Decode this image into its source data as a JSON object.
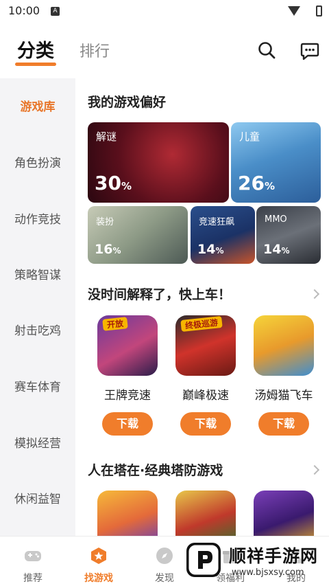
{
  "status_bar": {
    "time": "10:00",
    "notification_letter": "A"
  },
  "header": {
    "tab_category": "分类",
    "tab_ranking": "排行",
    "search_icon": "search-icon",
    "message_icon": "chat-icon",
    "accent": "#f07d2b"
  },
  "sidebar": {
    "items": [
      {
        "label": "游戏库",
        "active": true
      },
      {
        "label": "角色扮演"
      },
      {
        "label": "动作竞技"
      },
      {
        "label": "策略智谋"
      },
      {
        "label": "射击吃鸡"
      },
      {
        "label": "赛车体育"
      },
      {
        "label": "模拟经营"
      },
      {
        "label": "休闲益智"
      }
    ]
  },
  "preferences": {
    "title": "我的游戏偏好",
    "cards": [
      {
        "label": "解谜",
        "percent": "30",
        "unit": "%"
      },
      {
        "label": "儿童",
        "percent": "26",
        "unit": "%"
      },
      {
        "label": "装扮",
        "percent": "16",
        "unit": "%"
      },
      {
        "label": "竞速狂飙",
        "percent": "14",
        "unit": "%"
      },
      {
        "label": "MMO",
        "percent": "14",
        "unit": "%"
      }
    ]
  },
  "section_quick": {
    "title": "没时间解释了，快上车！",
    "games": [
      {
        "name": "王牌竞速",
        "badge": "开放",
        "download": "下载"
      },
      {
        "name": "巅峰极速",
        "badge": "终极巡游",
        "download": "下载"
      },
      {
        "name": "汤姆猫飞车",
        "download": "下载"
      }
    ]
  },
  "section_tower": {
    "title": "人在塔在·经典塔防游戏"
  },
  "bottom_nav": {
    "items": [
      {
        "label": "推荐",
        "icon": "gamepad-icon"
      },
      {
        "label": "找游戏",
        "icon": "hexagon-star-icon",
        "active": true
      },
      {
        "label": "发现",
        "icon": "compass-icon"
      },
      {
        "label": "领福利",
        "icon": "gift-icon"
      },
      {
        "label": "我的",
        "icon": "user-icon"
      }
    ]
  },
  "watermark": {
    "title": "顺祥手游网",
    "url": "www.bjsxsy.com"
  }
}
